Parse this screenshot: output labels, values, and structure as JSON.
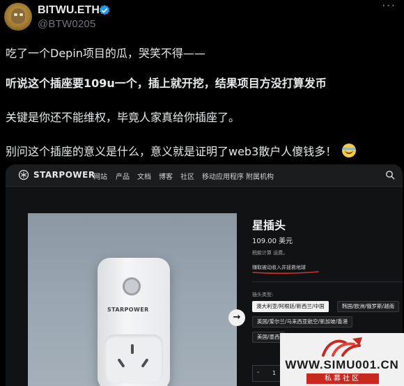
{
  "author": {
    "display_name": "BITWU.ETH",
    "handle": "@BTW0205",
    "avatar_icon": "nft-ape-avatar",
    "verified_icon": "verified-badge-icon"
  },
  "tweet": {
    "line1": "吃了一个Depin项目的瓜，哭笑不得——",
    "line2": "听说这个插座要109u一个，插上就开挖，结果项目方没打算发币",
    "line3": "关键是你还不能维权，毕竟人家真给你插座了。",
    "line4": "别问这个插座的意义是什么，意义就是证明了web3散户人傻钱多！",
    "line4_emoji": "laughing-tears-emoji"
  },
  "site": {
    "brand": "STARPOWER",
    "nav": [
      "网站",
      "产品",
      "文档",
      "博客",
      "社区",
      "移动应用程序",
      "附属机构"
    ],
    "search_icon": "search-icon"
  },
  "product": {
    "title": "星插头",
    "price": "109.00 美元",
    "tax_note": "税款计算 运费。",
    "earn_note": "赚取被动收入并拯救地球",
    "plug_brand": "STARPOWER",
    "plug_type_label": "插头类型:",
    "plug_types": [
      "澳大利亚/阿根廷/新西兰/中国",
      "韩国/欧洲/俄罗斯/越南",
      "英国/爱尔兰/马来西亚航空/新加坡/香港",
      "美国/墨西"
    ],
    "selected_plug_type": "澳大利亚/阿根廷/新西兰/中国",
    "quantity_minus": "-",
    "quantity": "1",
    "next_icon": "→"
  },
  "watermark": {
    "url": "WWW.SIMU001.CN",
    "caption": "私募社区"
  },
  "colors": {
    "background": "#000000",
    "text": "#e7e9ea",
    "secondary": "#71767b",
    "verified": "#1d9bf0",
    "watermark_red": "#c8281f"
  }
}
